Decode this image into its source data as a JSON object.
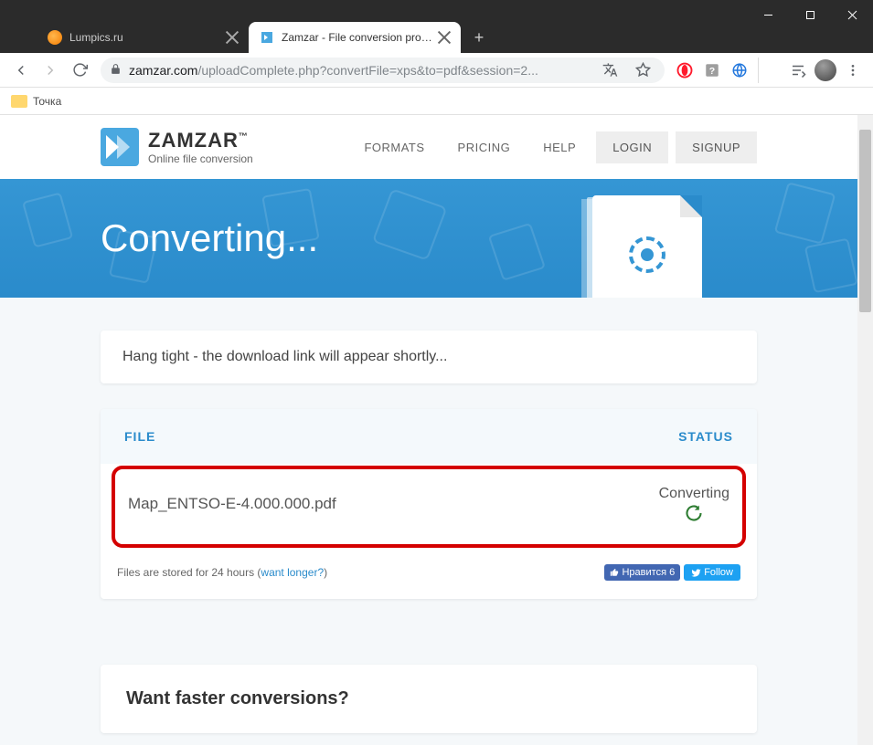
{
  "browser": {
    "tabs": [
      {
        "label": "Lumpics.ru",
        "active": false
      },
      {
        "label": "Zamzar - File conversion progress",
        "active": true
      }
    ],
    "url_host": "zamzar.com",
    "url_path": "/uploadComplete.php?convertFile=xps&to=pdf&session=2...",
    "bookmark": "Точка"
  },
  "site": {
    "brand": "ZAMZAR",
    "tagline": "Online file conversion",
    "nav": {
      "formats": "FORMATS",
      "pricing": "PRICING",
      "help": "HELP",
      "login": "LOGIN",
      "signup": "SIGNUP"
    }
  },
  "banner": {
    "title": "Converting..."
  },
  "message": "Hang tight - the download link will appear shortly...",
  "table": {
    "head_file": "FILE",
    "head_status": "STATUS",
    "file_name": "Map_ENTSO-E-4.000.000.pdf",
    "status_text": "Converting"
  },
  "footer": {
    "storage_prefix": "Files are stored for 24 hours (",
    "storage_link": "want longer?",
    "storage_suffix": ")",
    "fb_text": "Нравится 6",
    "tw_text": "Follow"
  },
  "promo": {
    "title": "Want faster conversions?"
  }
}
